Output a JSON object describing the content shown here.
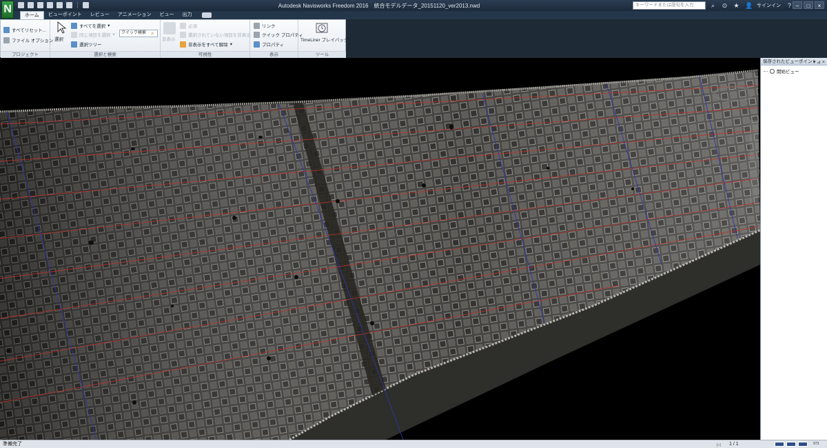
{
  "window": {
    "title": "Autodesk Navisworks Freedom 2016　統合モデルデータ_20151120_ver2013.nwd",
    "search_placeholder": "キーワードまたは語句を入力",
    "signin_label": "サインイン",
    "logo_letter": "N"
  },
  "tabs": [
    "ホーム",
    "ビューポイント",
    "レビュー",
    "アニメーション",
    "ビュー",
    "出力"
  ],
  "ribbon": {
    "project": {
      "label": "プロジェクト",
      "reset_all": "すべてリセット...",
      "file_options": "ファイル オプション"
    },
    "select_search": {
      "label": "選択と検索",
      "select": "選択",
      "select_all": "すべてを選択",
      "select_same": "同じ項目を選択",
      "selection_tree": "選択ツリー",
      "quick_search_value": "クイック検索"
    },
    "visibility": {
      "label": "可視性",
      "hide": "非表示",
      "require": "必須",
      "hide_unselected": "選択されていない項目を非表示",
      "unhide_all": "非表示をすべて解除"
    },
    "display": {
      "label": "表示",
      "links": "リンク",
      "quick_properties": "クイック プロパティ",
      "properties": "プロパティ"
    },
    "tools": {
      "label": "ツール",
      "timeliner": "TimeLiner プレイバック"
    }
  },
  "saved_viewpoints": {
    "title": "保存されたビューポイント",
    "items": [
      "開始ビュー"
    ]
  },
  "status": {
    "text": "準備完了",
    "page": "1 / 1",
    "memory": "973"
  },
  "colors": {
    "titlebar": "#1c2a3a",
    "ribbon_bg": "#eef2f6",
    "viewport_bg": "#000000",
    "grid_red": "#c0322c",
    "grid_blue": "#3036a8"
  }
}
